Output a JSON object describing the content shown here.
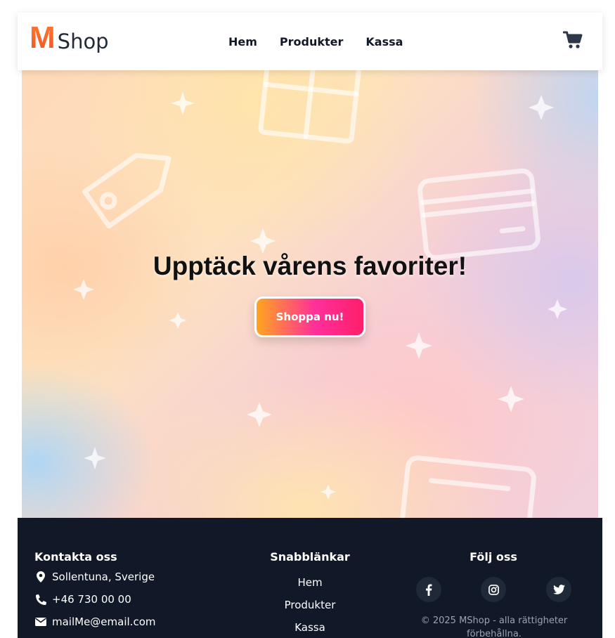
{
  "header": {
    "logo_initial": "M",
    "logo_rest": "Shop",
    "nav": [
      {
        "label": "Hem"
      },
      {
        "label": "Produkter"
      },
      {
        "label": "Kassa"
      }
    ],
    "cart_icon": "shopping-cart-icon"
  },
  "hero": {
    "title": "Upptäck vårens favoriter!",
    "cta_label": "Shoppa nu!",
    "decorations": [
      "gift-box-icon",
      "price-tag-icon",
      "credit-card-icon",
      "sparkle-icon"
    ]
  },
  "footer": {
    "contact": {
      "title": "Kontakta oss",
      "address": "Sollentuna, Sverige",
      "phone": "+46 730 00 00",
      "email": "mailMe@email.com"
    },
    "quick_links": {
      "title": "Snabblänkar",
      "items": [
        {
          "label": "Hem"
        },
        {
          "label": "Produkter"
        },
        {
          "label": "Kassa"
        }
      ]
    },
    "follow": {
      "title": "Följ oss",
      "socials": [
        "facebook-icon",
        "instagram-icon",
        "twitter-icon"
      ]
    },
    "copyright": "© 2025 MShop - alla rättigheter förbehållna."
  },
  "colors": {
    "footer_bg": "#111827",
    "logo_accent": "#f0532a",
    "cta_gradient": [
      "#ffa51f",
      "#ff2f9a",
      "#ff1f6b"
    ]
  }
}
